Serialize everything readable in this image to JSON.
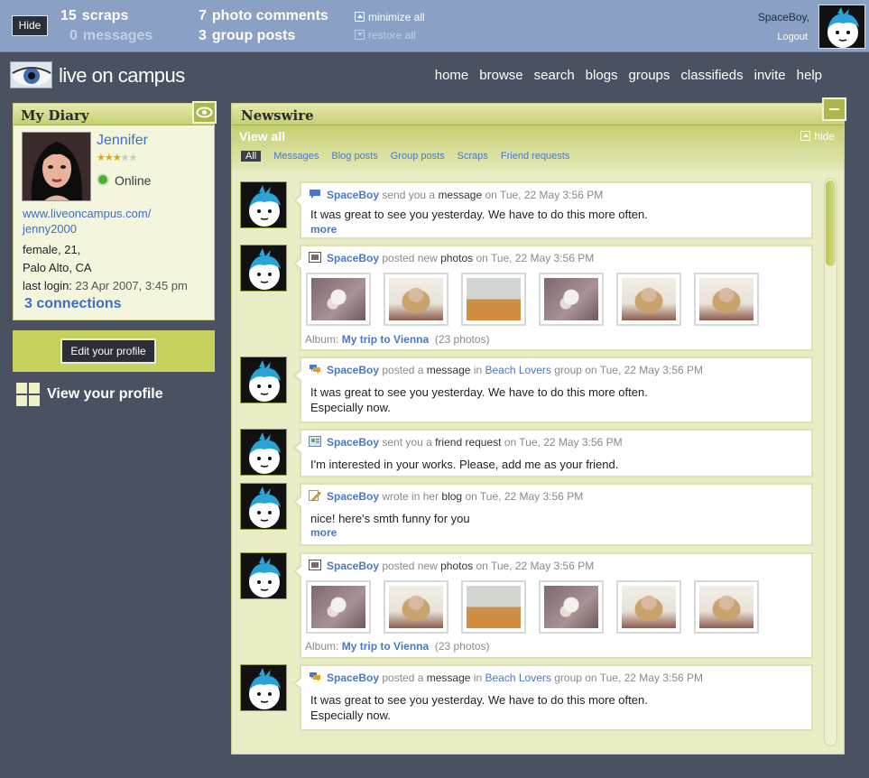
{
  "topbar": {
    "hide_label": "Hide",
    "scraps_count": "15",
    "scraps_label": "scraps",
    "messages_count": "0",
    "messages_label": "messages",
    "photo_comments_count": "7",
    "photo_comments_label": "photo comments",
    "group_posts_count": "3",
    "group_posts_label": "group posts",
    "minimize_all": "minimize all",
    "restore_all": "restore all",
    "user_name": "SpaceBoy,",
    "logout": "Logout"
  },
  "header": {
    "logo_text": "live on campus",
    "nav": [
      "home",
      "browse",
      "search",
      "blogs",
      "groups",
      "classifieds",
      "invite",
      "help"
    ]
  },
  "diary": {
    "title": "My Diary",
    "name": "Jennifer",
    "rating": 3,
    "rating_max": 5,
    "status": "Online",
    "url_line1": "www.liveoncampus.com/",
    "url_line2": "jenny2000",
    "gender_age": "female, 21,",
    "location": "Palo Alto, CA",
    "last_login_label": "last login:",
    "last_login_value": "23 Apr 2007, 3:45 pm",
    "connections": "3 connections"
  },
  "sidebar": {
    "edit_profile": "Edit your profile",
    "view_profile": "View your profile"
  },
  "newswire": {
    "title": "Newswire",
    "view_all": "View all",
    "hide": "hide",
    "filters": [
      "All",
      "Messages",
      "Blog posts",
      "Group posts",
      "Scraps",
      "Friend requests"
    ],
    "items": [
      {
        "icon": "speech-bubble-icon",
        "user": "SpaceBoy",
        "action": "send you a",
        "object": "message",
        "time": "on Tue, 22 May 3:56 PM",
        "text1": "It was great to see you yesterday. We have to do this more often.",
        "more": "more"
      },
      {
        "icon": "photo-icon",
        "user": "SpaceBoy",
        "action": "posted new",
        "object": "photos",
        "time": "on Tue, 22 May 3:56 PM",
        "album_label": "Album:",
        "album_name": "My trip to Vienna",
        "album_count": "(23 photos)"
      },
      {
        "icon": "group-message-icon",
        "user": "SpaceBoy",
        "action": "posted a",
        "object": "message",
        "in": "in",
        "group": "Beach Lovers",
        "time": "group on Tue, 22 May 3:56 PM",
        "text1": "It was great to see you yesterday. We have to do this more often.",
        "text2": "Especially now."
      },
      {
        "icon": "friend-request-icon",
        "user": "SpaceBoy",
        "action": "sent you a",
        "object": "friend request",
        "time": "on Tue, 22 May 3:56 PM",
        "text1": "I'm interested in your works. Please, add me as your friend."
      },
      {
        "icon": "blog-pencil-icon",
        "user": "SpaceBoy",
        "action": "wrote in her",
        "object": "blog",
        "time": "on Tue, 22 May 3:56 PM",
        "text1": "nice! here's smth funny for you",
        "more": "more"
      },
      {
        "icon": "photo-icon",
        "user": "SpaceBoy",
        "action": "posted new",
        "object": "photos",
        "time": "on Tue, 22 May 3:56 PM",
        "album_label": "Album:",
        "album_name": "My trip to Vienna",
        "album_count": "(23 photos)"
      },
      {
        "icon": "group-message-icon",
        "user": "SpaceBoy",
        "action": "posted a",
        "object": "message",
        "in": "in",
        "group": "Beach Lovers",
        "time": "group on Tue, 22 May 3:56 PM",
        "text1": "It was great to see you yesterday. We have to do this more often.",
        "text2": "Especially now."
      }
    ]
  },
  "colors": {
    "topbar_bg": "#8aa0c4",
    "page_bg": "#4a5160",
    "panel_header": "#c7cf72",
    "link_blue": "#4a78c4"
  }
}
